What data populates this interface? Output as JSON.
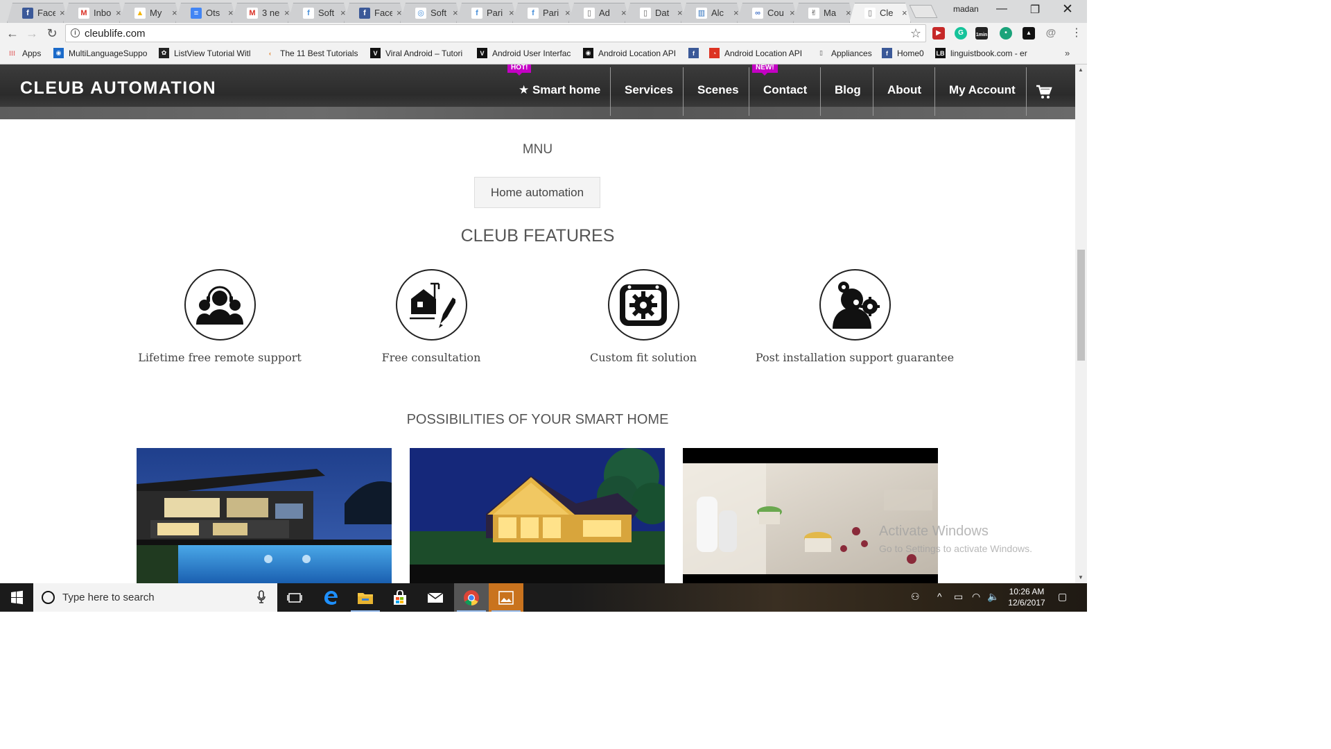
{
  "browser": {
    "tabs": [
      {
        "label": "Face",
        "fav": "f",
        "favbg": "#3b5998",
        "favfg": "#fff"
      },
      {
        "label": "Inbo",
        "fav": "M",
        "favbg": "#fff",
        "favfg": "#d93025"
      },
      {
        "label": "My",
        "fav": "▲",
        "favbg": "#fff",
        "favfg": "#f4b400"
      },
      {
        "label": "Ots",
        "fav": "≡",
        "favbg": "#4285f4",
        "favfg": "#fff"
      },
      {
        "label": "3 ne",
        "fav": "M",
        "favbg": "#fff",
        "favfg": "#d93025"
      },
      {
        "label": "Soft",
        "fav": "f",
        "favbg": "#fff",
        "favfg": "#4a90d9"
      },
      {
        "label": "Face",
        "fav": "f",
        "favbg": "#3b5998",
        "favfg": "#fff"
      },
      {
        "label": "Soft",
        "fav": "◎",
        "favbg": "#fff",
        "favfg": "#4a90d9"
      },
      {
        "label": "Pari",
        "fav": "f",
        "favbg": "#fff",
        "favfg": "#4a90d9"
      },
      {
        "label": "Pari",
        "fav": "f",
        "favbg": "#fff",
        "favfg": "#4a90d9"
      },
      {
        "label": "Ad",
        "fav": "▯",
        "favbg": "#fff",
        "favfg": "#666"
      },
      {
        "label": "Dat",
        "fav": "▯",
        "favbg": "#fff",
        "favfg": "#666"
      },
      {
        "label": "Alc",
        "fav": "▥",
        "favbg": "#fff",
        "favfg": "#2a6ebb"
      },
      {
        "label": "Cou",
        "fav": "∞",
        "favbg": "#fff",
        "favfg": "#4a77c9"
      },
      {
        "label": "Ma",
        "fav": "✌",
        "favbg": "#fff",
        "favfg": "#333"
      },
      {
        "label": "Cle",
        "fav": "▯",
        "favbg": "#fff",
        "favfg": "#666"
      }
    ],
    "close_glyph": "×",
    "user": "madan",
    "url": "cleublife.com",
    "info_glyph": "i",
    "star_glyph": "☆",
    "ext_1min": "1min",
    "menu_glyph": "⋮",
    "more_bookmarks": "»",
    "bookmarks": [
      {
        "label": "Apps",
        "fav": "⁞⁞⁞",
        "favbg": "transparent",
        "favfg": "#d44"
      },
      {
        "label": "MultiLanguageSuppo",
        "fav": "◉",
        "favbg": "#1b6ac9",
        "favfg": "#fff"
      },
      {
        "label": "ListView Tutorial Witl",
        "fav": "✿",
        "favbg": "#222",
        "favfg": "#fff"
      },
      {
        "label": "The 11 Best Tutorials",
        "fav": "‹",
        "favbg": "transparent",
        "favfg": "#e07a1f"
      },
      {
        "label": "Viral Android – Tutori",
        "fav": "V",
        "favbg": "#111",
        "favfg": "#fff"
      },
      {
        "label": "Android User Interfac",
        "fav": "V",
        "favbg": "#111",
        "favfg": "#fff"
      },
      {
        "label": "Android Location API",
        "fav": "◉",
        "favbg": "#111",
        "favfg": "#fff"
      },
      {
        "label": "",
        "fav": "f",
        "favbg": "#3b5998",
        "favfg": "#fff"
      },
      {
        "label": "Android Location API",
        "fav": "◔",
        "favbg": "#d32",
        "favfg": "#fff"
      },
      {
        "label": "Appliances",
        "fav": "▯",
        "favbg": "transparent",
        "favfg": "#555"
      },
      {
        "label": "Home0",
        "fav": "f",
        "favbg": "#3b5998",
        "favfg": "#fff"
      },
      {
        "label": "linguistbook.com - er",
        "fav": "LB",
        "favbg": "#111",
        "favfg": "#fff"
      }
    ]
  },
  "site": {
    "brand": "CLEUB AUTOMATION",
    "nav": [
      {
        "label": "★ Smart home",
        "badge": "HOT!"
      },
      {
        "label": "Services",
        "badge": ""
      },
      {
        "label": "Scenes",
        "badge": ""
      },
      {
        "label": "Contact",
        "badge": "NEW!"
      },
      {
        "label": "Blog",
        "badge": ""
      },
      {
        "label": "About",
        "badge": ""
      },
      {
        "label": "My Account",
        "badge": ""
      }
    ],
    "mnu_heading": "MNU",
    "home_automation_button": "Home automation",
    "features_title": "CLEUB FEATURES",
    "features": [
      {
        "label": "Lifetime free remote support",
        "icon": "support-team-icon"
      },
      {
        "label": "Free consultation",
        "icon": "house-design-icon"
      },
      {
        "label": "Custom fit solution",
        "icon": "gear-device-icon"
      },
      {
        "label": "Post installation support guarantee",
        "icon": "user-gears-icon"
      }
    ],
    "possibilities_title": "POSSIBILITIES OF YOUR SMART HOME"
  },
  "os": {
    "activate_title": "Activate Windows",
    "activate_sub": "Go to Settings to activate Windows.",
    "search_placeholder": "Type here to search",
    "time": "10:26 AM",
    "date": "12/6/2017"
  },
  "colors": {
    "badge": "#c400c4",
    "header_bg": "#2f2f2f",
    "taskbar": "#1b1b1b",
    "chrome_frame": "#dadbdc"
  }
}
